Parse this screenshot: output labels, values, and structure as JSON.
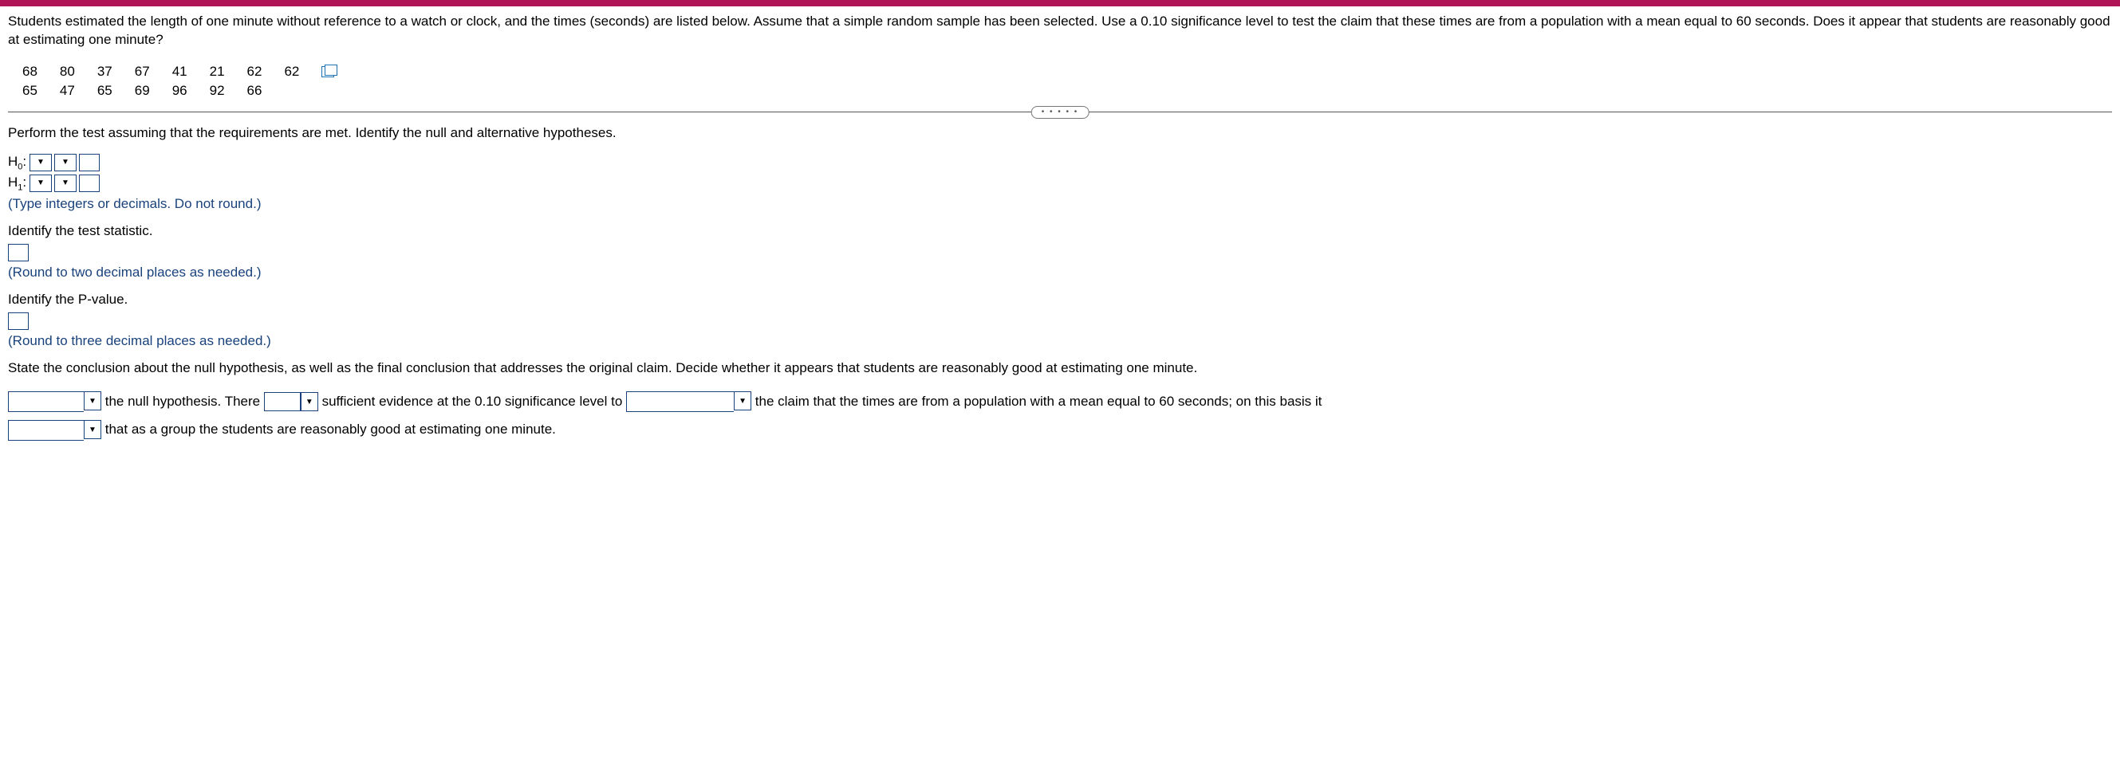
{
  "problem": {
    "text": "Students estimated the length of one minute without reference to a watch or clock, and the times (seconds) are listed below. Assume that a simple random sample has been selected. Use a 0.10 significance level to test the claim that these times are from a population with a mean equal to 60 seconds. Does it appear that students are reasonably good at estimating one minute?"
  },
  "data_table": {
    "row1": [
      "68",
      "80",
      "37",
      "67",
      "41",
      "21",
      "62",
      "62"
    ],
    "row2": [
      "65",
      "47",
      "65",
      "69",
      "96",
      "92",
      "66",
      ""
    ]
  },
  "sections": {
    "hyp_prompt": "Perform the test assuming that the requirements are met. Identify the null and alternative hypotheses.",
    "h0_label": "H",
    "h0_sub": "0",
    "h1_label": "H",
    "h1_sub": "1",
    "colon": ":",
    "hyp_hint": "(Type integers or decimals. Do not round.)",
    "stat_prompt": "Identify the test statistic.",
    "stat_hint": "(Round to two decimal places as needed.)",
    "pval_prompt": "Identify the P-value.",
    "pval_hint": "(Round to three decimal places as needed.)",
    "concl_prompt": "State the conclusion about the null hypothesis, as well as the final conclusion that addresses the original claim. Decide whether it appears that students are reasonably good at estimating one minute.",
    "concl_part1": " the null hypothesis. There ",
    "concl_part2": " sufficient evidence at the 0.10 significance level to ",
    "concl_part3": " the claim that the times are from a population with a mean equal to 60 seconds; on this basis it ",
    "concl_part4": " that as a group the students are reasonably good at estimating one minute."
  }
}
